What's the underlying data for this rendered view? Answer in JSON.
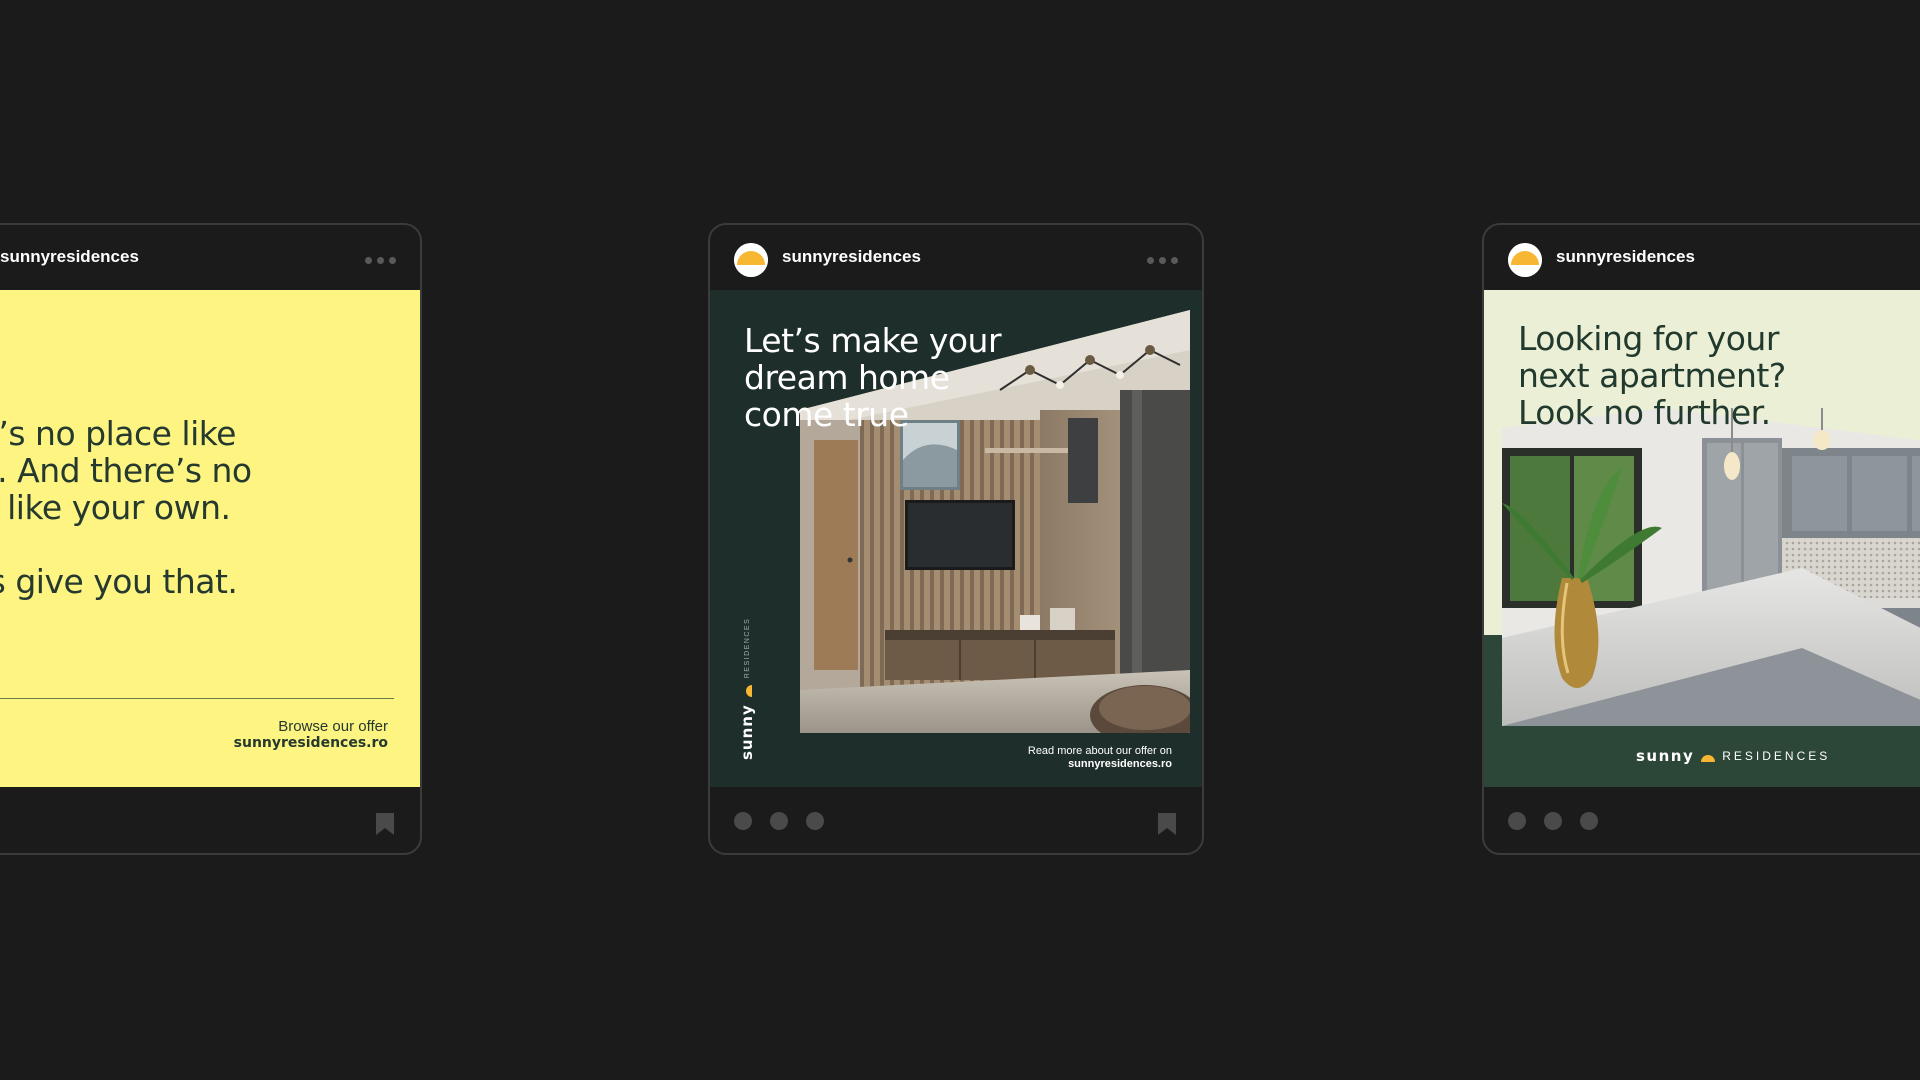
{
  "colors": {
    "background": "#1b1b1b",
    "sun_yellow": "#f7b733",
    "post1_bg": "#fdf481",
    "post2_bg": "#1e2e2a",
    "post3_bg": "#eaefd6",
    "post3_band": "#2c4638"
  },
  "posts": [
    {
      "username": "sunnyresidences",
      "avatar_icon": "sun-logo-icon",
      "more_icon": "more-dots-icon",
      "creative": {
        "lines_1": [
          "here’s no place like",
          "ome. And there’s no",
          "ome like your own."
        ],
        "lines_2": [
          "et us give you that."
        ],
        "browse_label": "Browse our offer",
        "browse_url": "sunnyresidences.ro"
      },
      "bookmark_icon": "bookmark-icon"
    },
    {
      "username": "sunnyresidences",
      "avatar_icon": "sun-logo-icon",
      "more_icon": "more-dots-icon",
      "creative": {
        "title_lines": [
          "Let’s make your",
          "dream home",
          "come true"
        ],
        "photo_icon": "living-room-photo",
        "logo_word": "sunny",
        "logo_sub": "RESIDENCES",
        "read_label": "Read more about our offer on",
        "read_url": "sunnyresidences.ro"
      },
      "bookmark_icon": "bookmark-icon"
    },
    {
      "username": "sunnyresidences",
      "avatar_icon": "sun-logo-icon",
      "more_icon": "more-dots-icon",
      "creative": {
        "title_lines": [
          "Looking for your",
          "next apartment?",
          "Look no further."
        ],
        "photo_icon": "kitchen-photo",
        "logo_word": "sunny",
        "logo_sub": "RESIDENCES"
      }
    }
  ]
}
